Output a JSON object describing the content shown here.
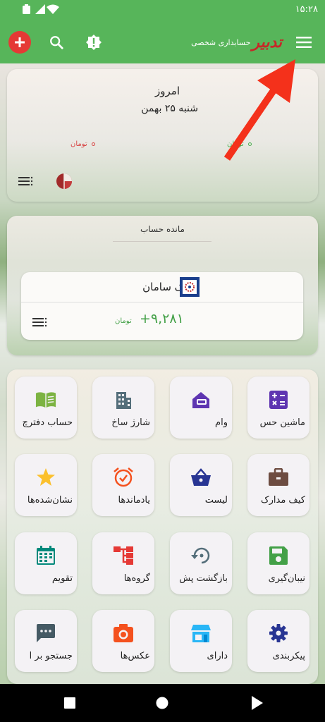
{
  "status_bar": {
    "time": "۱۵:۲۸"
  },
  "app_bar": {
    "logo_mark": "تدبیر",
    "logo_subtitle": "حسابداری شخصی",
    "icons": [
      "add-icon",
      "search-icon",
      "alert-icon",
      "menu-icon"
    ]
  },
  "today": {
    "title": "امروز",
    "date": "شنبه ۲۵ بهمن",
    "expense_unit": "تومان",
    "income_unit": "تومان"
  },
  "balance": {
    "title": "مانده حساب",
    "bank_name": "بانک سامان",
    "amount": "+۹,۲۸۱",
    "unit": "تومان"
  },
  "grid": [
    {
      "label": "ماشین حس",
      "icon": "calculator-icon",
      "color": "#5e35b1"
    },
    {
      "label": "وام",
      "icon": "loan-icon",
      "color": "#5e35b1"
    },
    {
      "label": "شارژ ساخ",
      "icon": "building-icon",
      "color": "#546e7a"
    },
    {
      "label": "حساب دفترچ",
      "icon": "book-icon",
      "color": "#7cb342"
    },
    {
      "label": "کیف مدارک",
      "icon": "briefcase-icon",
      "color": "#6d4c41"
    },
    {
      "label": "لیست",
      "icon": "basket-icon",
      "color": "#283593"
    },
    {
      "label": "یادماندها",
      "icon": "alarm-icon",
      "color": "#f4511e"
    },
    {
      "label": "نشان‌شده‌ها",
      "icon": "star-icon",
      "color": "#fbc02d"
    },
    {
      "label": "نیبان‌گیری",
      "icon": "save-icon",
      "color": "#43a047"
    },
    {
      "label": "بازگشت پش",
      "icon": "restore-icon",
      "color": "#546e7a"
    },
    {
      "label": "گروه‌ها",
      "icon": "groups-icon",
      "color": "#e53935"
    },
    {
      "label": "تقویم",
      "icon": "calendar-icon",
      "color": "#00897b"
    },
    {
      "label": "پیکربندی",
      "icon": "gear-icon",
      "color": "#283593"
    },
    {
      "label": "دارای",
      "icon": "store-icon",
      "color": "#29b6f6"
    },
    {
      "label": "عکس‌ها",
      "icon": "camera-icon",
      "color": "#f4511e"
    },
    {
      "label": "جستجو بر ا",
      "icon": "chat-icon",
      "color": "#455a64"
    }
  ],
  "colors": {
    "primary": "#57b55a",
    "add_button": "#e53935",
    "amount": "#43a047",
    "arrow": "#f4311b"
  }
}
